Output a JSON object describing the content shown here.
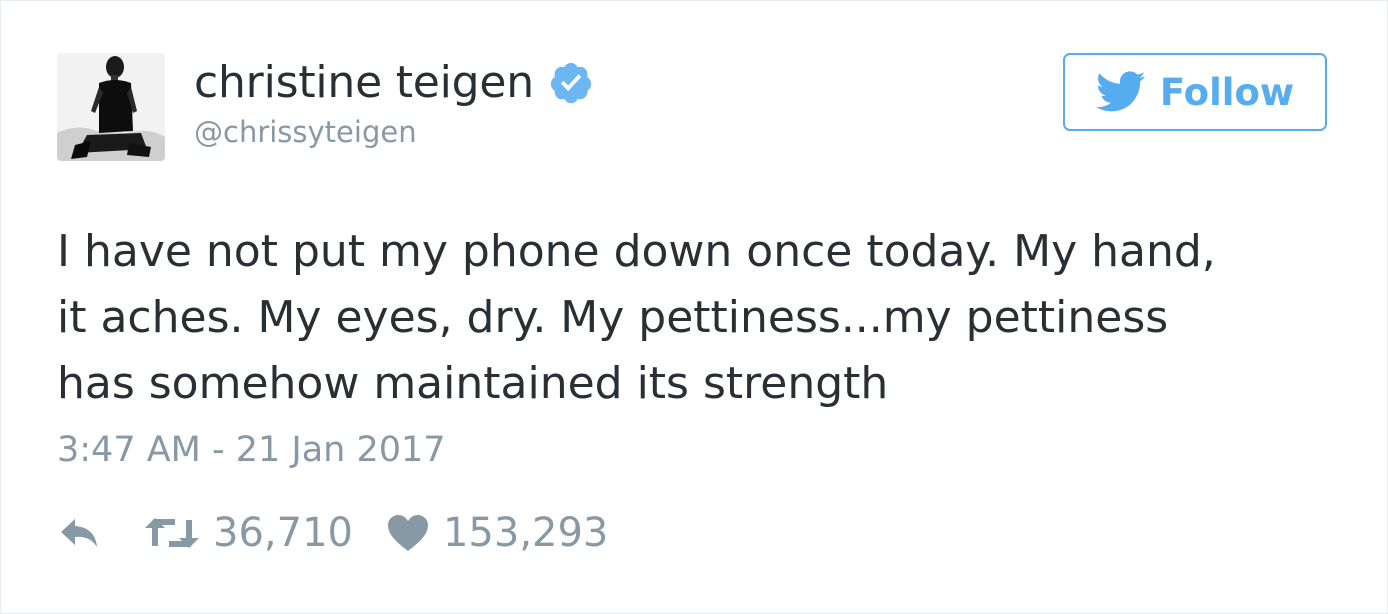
{
  "author": {
    "display_name": "christine teigen",
    "handle": "@chrissyteigen",
    "verified": true,
    "avatar_icon": "profile-photo"
  },
  "follow_button": {
    "label": "Follow",
    "icon": "twitter-bird-icon",
    "color": "#55acee"
  },
  "tweet": {
    "text": "I have not put my phone down once today. My hand,\nit aches. My eyes, dry. My pettiness...my pettiness\nhas somehow maintained its strength",
    "timestamp": "3:47 AM - 21 Jan 2017"
  },
  "actions": {
    "reply": {
      "icon": "reply-icon"
    },
    "retweet": {
      "icon": "retweet-icon",
      "count": "36,710"
    },
    "like": {
      "icon": "heart-icon",
      "count": "153,293"
    }
  },
  "colors": {
    "text": "#292f33",
    "muted": "#8899a6",
    "accent": "#55acee",
    "verified_badge": "#6cb6f2"
  }
}
